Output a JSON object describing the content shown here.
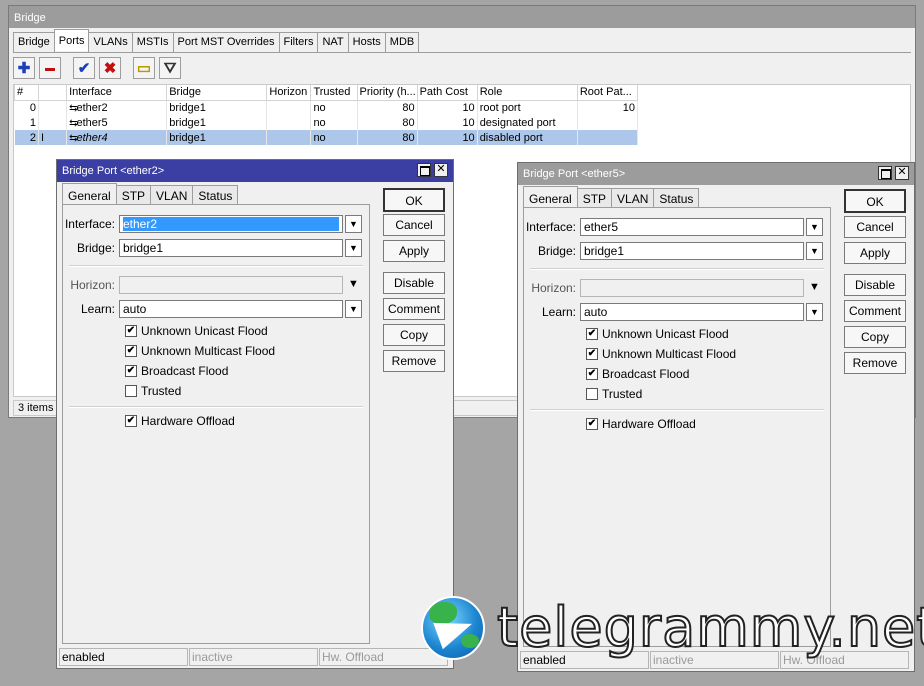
{
  "main": {
    "title": "Bridge",
    "tabs": [
      "Bridge",
      "Ports",
      "VLANs",
      "MSTIs",
      "Port MST Overrides",
      "Filters",
      "NAT",
      "Hosts",
      "MDB"
    ],
    "active_tab": "Ports",
    "toolbar_icons": [
      "add-icon",
      "remove-icon",
      "enable-icon",
      "disable-icon",
      "comment-icon",
      "filter-icon"
    ],
    "toolbar_glyphs": {
      "add": "✚",
      "remove": "▬",
      "enable": "✔",
      "disable": "✖",
      "comment": "▭",
      "filter": "⛛"
    },
    "columns": [
      "#",
      "",
      "Interface",
      "Bridge",
      "Horizon",
      "Trusted",
      "Priority (h...",
      "Path Cost",
      "Role",
      "Root Pat..."
    ],
    "rows": [
      {
        "num": "0",
        "flag": "",
        "icon": "⇆",
        "interface": "ether2",
        "bridge": "bridge1",
        "horizon": "",
        "trusted": "no",
        "priority": "80",
        "path_cost": "10",
        "role": "root port",
        "root_path": "10"
      },
      {
        "num": "1",
        "flag": "",
        "icon": "⇆",
        "interface": "ether5",
        "bridge": "bridge1",
        "horizon": "",
        "trusted": "no",
        "priority": "80",
        "path_cost": "10",
        "role": "designated port",
        "root_path": ""
      },
      {
        "num": "2",
        "flag": "I",
        "icon": "⇆",
        "interface": "ether4",
        "bridge": "bridge1",
        "horizon": "",
        "trusted": "no",
        "priority": "80",
        "path_cost": "10",
        "role": "disabled port",
        "root_path": ""
      }
    ],
    "status": "3 items ("
  },
  "dialog1": {
    "title": "Bridge Port <ether2>",
    "tabs": [
      "General",
      "STP",
      "VLAN",
      "Status"
    ],
    "interface_label": "Interface:",
    "interface_value": "ether2",
    "bridge_label": "Bridge:",
    "bridge_value": "bridge1",
    "horizon_label": "Horizon:",
    "horizon_value": "",
    "learn_label": "Learn:",
    "learn_value": "auto",
    "checks": [
      {
        "label": "Unknown Unicast Flood",
        "checked": true
      },
      {
        "label": "Unknown Multicast Flood",
        "checked": true
      },
      {
        "label": "Broadcast Flood",
        "checked": true
      },
      {
        "label": "Trusted",
        "checked": false
      }
    ],
    "hw_offload": {
      "label": "Hardware Offload",
      "checked": true
    },
    "buttons": [
      "OK",
      "Cancel",
      "Apply",
      "Disable",
      "Comment",
      "Copy",
      "Remove"
    ],
    "status": [
      "enabled",
      "inactive",
      "Hw. Offload"
    ]
  },
  "dialog2": {
    "title": "Bridge Port <ether5>",
    "tabs": [
      "General",
      "STP",
      "VLAN",
      "Status"
    ],
    "interface_label": "Interface:",
    "interface_value": "ether5",
    "bridge_label": "Bridge:",
    "bridge_value": "bridge1",
    "horizon_label": "Horizon:",
    "horizon_value": "",
    "learn_label": "Learn:",
    "learn_value": "auto",
    "checks": [
      {
        "label": "Unknown Unicast Flood",
        "checked": true
      },
      {
        "label": "Unknown Multicast Flood",
        "checked": true
      },
      {
        "label": "Broadcast Flood",
        "checked": true
      },
      {
        "label": "Trusted",
        "checked": false
      }
    ],
    "hw_offload": {
      "label": "Hardware Offload",
      "checked": true
    },
    "buttons": [
      "OK",
      "Cancel",
      "Apply",
      "Disable",
      "Comment",
      "Copy",
      "Remove"
    ],
    "status": [
      "enabled",
      "inactive",
      "Hw. Offload"
    ]
  },
  "glyphs": {
    "check": "✔",
    "dropdown": "▼",
    "dropdown_alt": "⯆",
    "close": "✕"
  },
  "watermark": "telegrammy.net",
  "colors": {
    "selected_row": "#adc7ea",
    "active_title": "#3b3fa3",
    "inactive_title": "#9c9c9c",
    "selection": "#3399ff"
  }
}
